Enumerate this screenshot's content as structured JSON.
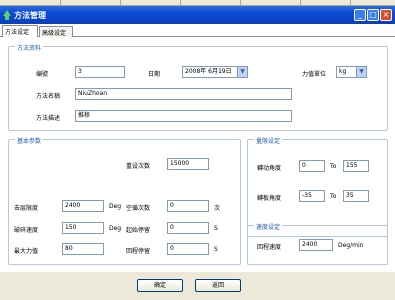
{
  "window": {
    "title": "方法管理"
  },
  "tabs": [
    {
      "label": "方法设定"
    },
    {
      "label": "高级设定"
    }
  ],
  "method_settings": {
    "legend": "方法资料",
    "number_label": "编號",
    "number_value": "3",
    "date_label": "日期",
    "date_value": "2008年 6月19日",
    "unit_label": "力值單位",
    "unit_value": "kg",
    "name_label": "方法名稱",
    "name_value": "NiuZhoan",
    "desc_label": "方法描述",
    "desc_value": "推移"
  },
  "basic_params": {
    "legend": "基本参数",
    "tare_label": "重设次数",
    "tare_value": "15000",
    "max_stroke_label": "击层限度",
    "max_stroke_value": "2400",
    "max_stroke_unit": "Deg",
    "empty_count_label": "空循次数",
    "empty_count_value": "0",
    "empty_count_unit": "次",
    "zero_speed_label": "破碎速度",
    "zero_speed_value": "150",
    "zero_speed_unit": "Deg",
    "start_wait_label": "起始停留",
    "start_wait_value": "0",
    "start_wait_unit": "S",
    "max_force_label": "最大力值",
    "max_force_value": "80",
    "return_wait_label": "回程停留",
    "return_wait_value": "0",
    "return_wait_unit": "S"
  },
  "range_settings": {
    "legend": "量限设定",
    "angle_label": "轉动角度",
    "angle_from": "0",
    "angle_to_label": "To",
    "angle_to": "155",
    "rotate_label": "轉板角度",
    "rotate_from": "-35",
    "rotate_to_label": "To",
    "rotate_to": "35"
  },
  "speed_settings": {
    "legend": "速度设定",
    "return_speed_label": "回程速度",
    "return_speed_value": "2400",
    "return_speed_unit": "Deg/min"
  },
  "footer": {
    "ok_label": "确定",
    "back_label": "返回"
  }
}
